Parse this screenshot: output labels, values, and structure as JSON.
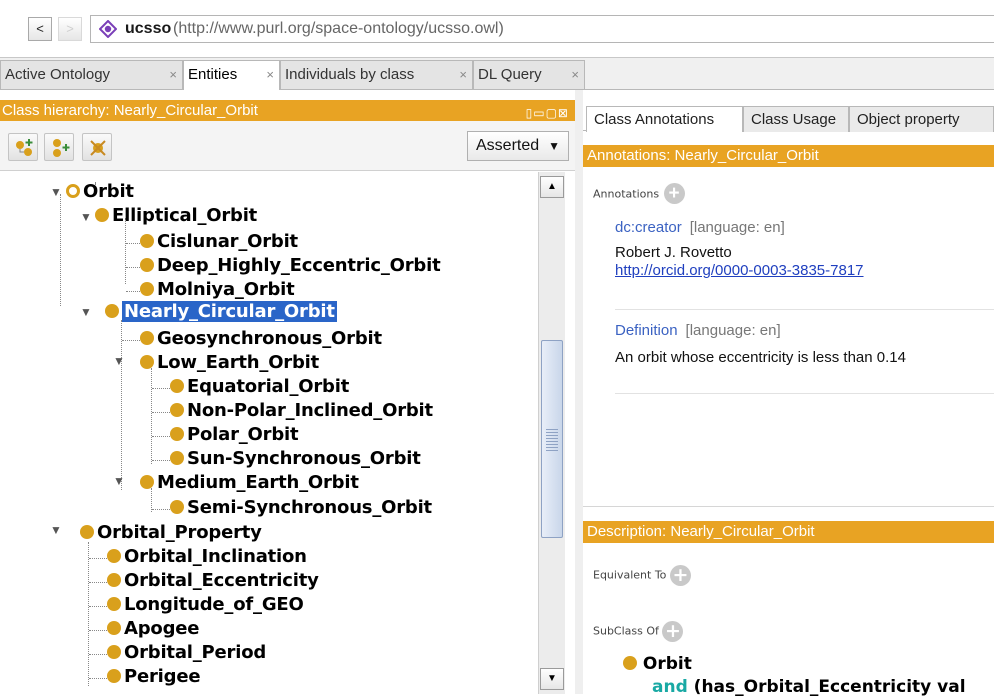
{
  "nav": {
    "back_label": "<",
    "forward_label": ">",
    "ontology_name": "ucsso",
    "ontology_iri": "(http://www.purl.org/space-ontology/ucsso.owl)"
  },
  "tabs": [
    {
      "label": "Active Ontology",
      "close": "×"
    },
    {
      "label": "Entities",
      "close": "×"
    },
    {
      "label": "Individuals by class",
      "close": "×"
    },
    {
      "label": "DL Query",
      "close": "×"
    }
  ],
  "left_panel": {
    "header": "Class hierarchy: Nearly_Circular_Orbit",
    "window_buttons": "▯▭▢⊠",
    "asserted": "Asserted",
    "tree": [
      {
        "label": "Orbit"
      },
      {
        "label": "Elliptical_Orbit"
      },
      {
        "label": "Cislunar_Orbit"
      },
      {
        "label": "Deep_Highly_Eccentric_Orbit"
      },
      {
        "label": "Molniya_Orbit"
      },
      {
        "label": "Nearly_Circular_Orbit"
      },
      {
        "label": "Geosynchronous_Orbit"
      },
      {
        "label": "Low_Earth_Orbit"
      },
      {
        "label": "Equatorial_Orbit"
      },
      {
        "label": "Non-Polar_Inclined_Orbit"
      },
      {
        "label": "Polar_Orbit"
      },
      {
        "label": "Sun-Synchronous_Orbit"
      },
      {
        "label": "Medium_Earth_Orbit"
      },
      {
        "label": "Semi-Synchronous_Orbit"
      },
      {
        "label": "Orbital_Property"
      },
      {
        "label": "Orbital_Inclination"
      },
      {
        "label": "Orbital_Eccentricity"
      },
      {
        "label": "Longitude_of_GEO"
      },
      {
        "label": "Apogee"
      },
      {
        "label": "Orbital_Period"
      },
      {
        "label": "Perigee"
      }
    ]
  },
  "right_panel": {
    "tabs": [
      "Class Annotations",
      "Class Usage",
      "Object property"
    ],
    "annotations_header": "Annotations: Nearly_Circular_Orbit",
    "annotations_label": "Annotations",
    "annotations": [
      {
        "property": "dc:creator",
        "lang": "[language: en]",
        "value": "Robert J. Rovetto",
        "link": "http://orcid.org/0000-0003-3835-7817"
      },
      {
        "property": "Definition",
        "lang": "[language: en]",
        "value": "An orbit whose eccentricity is less than 0.14"
      }
    ],
    "description_header": "Description: Nearly_Circular_Orbit",
    "equivalent_to": "Equivalent To",
    "subclass_of": "SubClass Of",
    "subclass_class": "Orbit",
    "subclass_expr_kw": "and",
    "subclass_expr": "(has_Orbital_Eccentricity val"
  },
  "colors": {
    "header_orange": "#e8a323",
    "class_dot": "#d9a01c",
    "selection": "#2a65c8",
    "link_blue": "#3b62c2",
    "keyword_teal": "#19a9a4"
  }
}
